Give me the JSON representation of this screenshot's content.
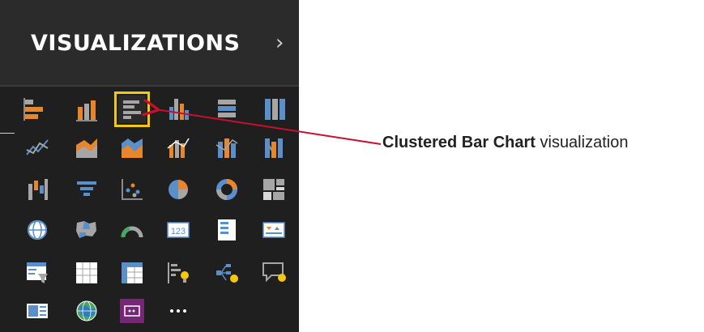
{
  "panel": {
    "title": "VISUALIZATIONS",
    "collapse_icon": "chevron-right-icon"
  },
  "annotation": {
    "bold": "Clustered Bar Chart",
    "rest": " visualization",
    "arrow_color": "#c8102e"
  },
  "icons": [
    "stacked-bar-icon",
    "stacked-column-icon",
    "clustered-bar-icon",
    "clustered-column-icon",
    "100-stacked-bar-icon",
    "100-stacked-column-icon",
    "line-chart-icon",
    "area-chart-icon",
    "stacked-area-icon",
    "line-clustered-column-icon",
    "line-stacked-column-icon",
    "ribbon-chart-icon",
    "waterfall-chart-icon",
    "funnel-chart-icon",
    "scatter-chart-icon",
    "pie-chart-icon",
    "donut-chart-icon",
    "treemap-icon",
    "map-icon",
    "filled-map-icon",
    "gauge-icon",
    "card-icon",
    "multi-row-card-icon",
    "kpi-icon",
    "slicer-icon",
    "table-icon",
    "matrix-icon",
    "key-influencers-icon",
    "decomposition-tree-icon",
    "qa-icon",
    "custom-visual-icon",
    "arcgis-map-icon",
    "power-apps-icon",
    "more-options-icon"
  ],
  "card_text": "123",
  "selected_index": 2,
  "colors": {
    "accent": "#f2c811",
    "orange": "#e8862e",
    "blue": "#5b8fc9",
    "gray": "#a6a6a6",
    "purple": "#742774"
  }
}
